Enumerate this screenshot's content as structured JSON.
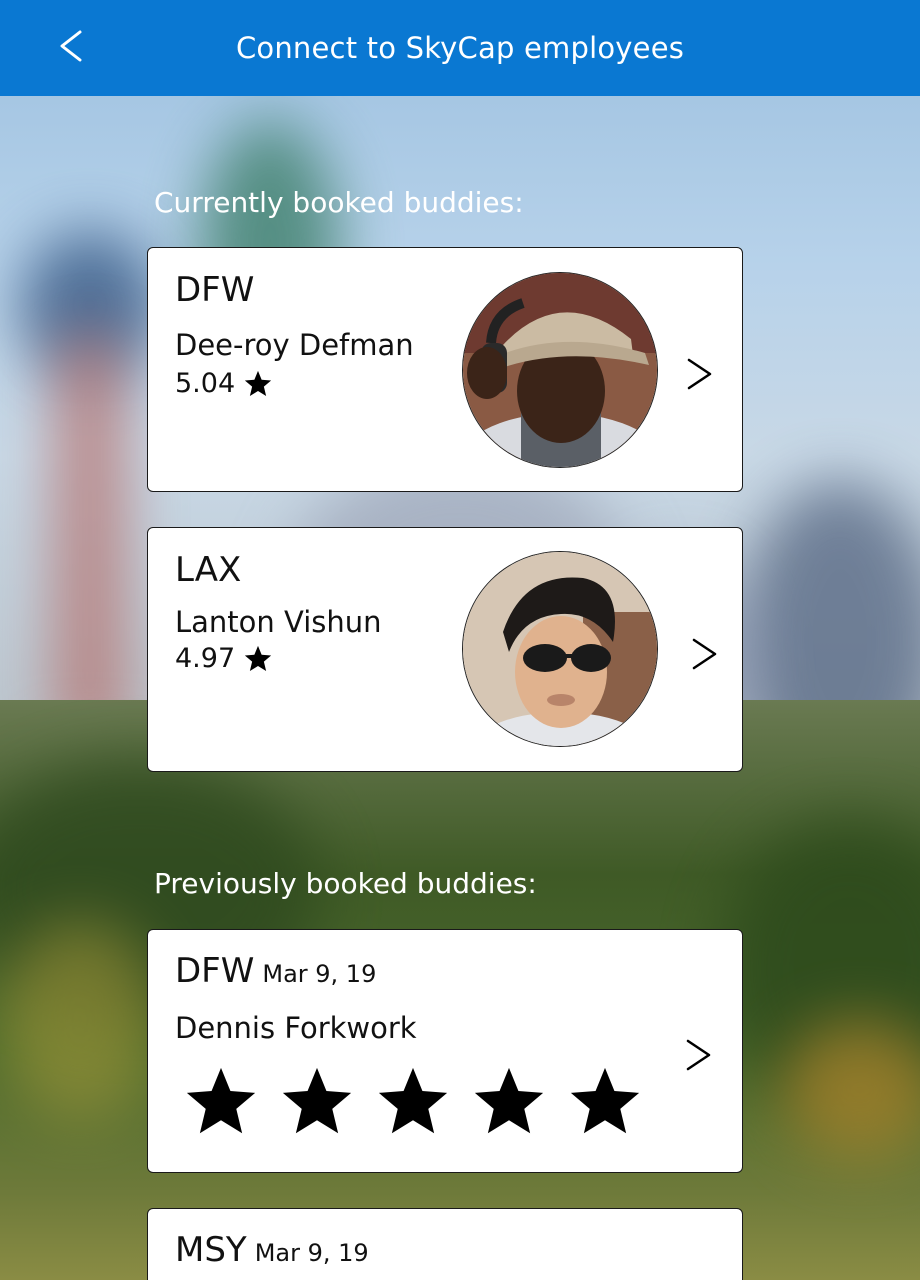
{
  "header": {
    "title": "Connect to SkyCap employees"
  },
  "current_section": {
    "label": "Currently booked buddies:",
    "buddies": [
      {
        "airport": "DFW",
        "name": "Dee-roy Defman",
        "rating": "5.04"
      },
      {
        "airport": "LAX",
        "name": "Lanton Vishun",
        "rating": "4.97"
      }
    ]
  },
  "previous_section": {
    "label": "Previously booked buddies:",
    "buddies": [
      {
        "airport": "DFW",
        "date": "Mar 9, 19",
        "name": "Dennis Forkwork",
        "stars": 5
      },
      {
        "airport": "MSY",
        "date": "Mar 9, 19"
      }
    ]
  },
  "colors": {
    "header": "#0a78d2",
    "card": "#ffffff",
    "text": "#111111"
  },
  "icons": {
    "back": "chevron-left-icon",
    "forward": "chevron-right-icon",
    "rating": "star-icon"
  }
}
